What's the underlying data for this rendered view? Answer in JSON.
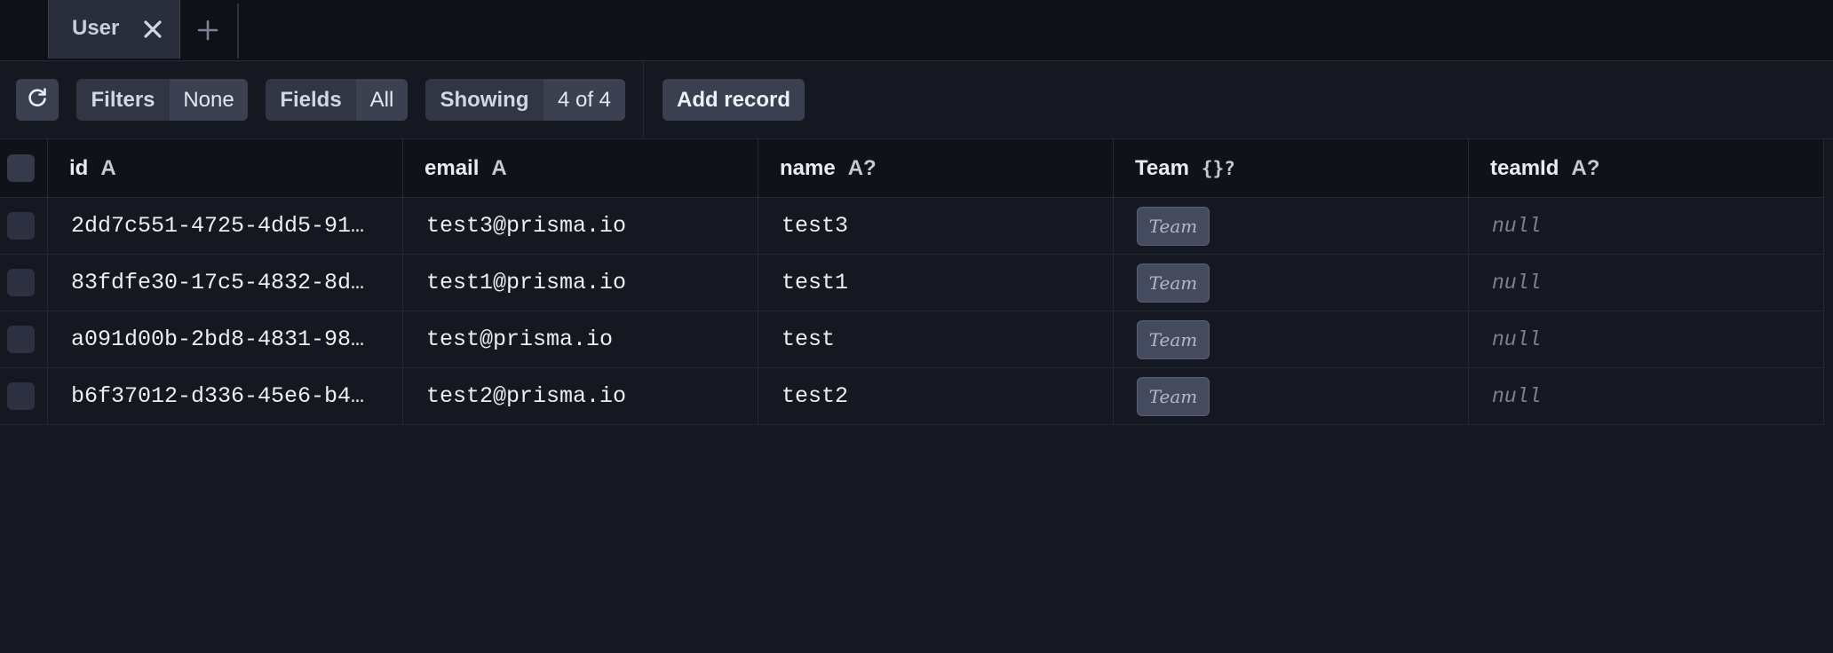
{
  "tabs": [
    {
      "label": "User",
      "active": true
    }
  ],
  "toolbar": {
    "filters_label": "Filters",
    "filters_value": "None",
    "fields_label": "Fields",
    "fields_value": "All",
    "showing_label": "Showing",
    "showing_value": "4 of 4",
    "add_record_label": "Add record"
  },
  "table": {
    "columns": [
      {
        "name": "id",
        "type": "A"
      },
      {
        "name": "email",
        "type": "A"
      },
      {
        "name": "name",
        "type": "A?"
      },
      {
        "name": "Team",
        "type": "{}?"
      },
      {
        "name": "teamId",
        "type": "A?"
      }
    ],
    "rows": [
      {
        "id": "2dd7c551-4725-4dd5-91…",
        "email": "test3@prisma.io",
        "name": "test3",
        "team": "Team",
        "teamId": "null"
      },
      {
        "id": "83fdfe30-17c5-4832-8d…",
        "email": "test1@prisma.io",
        "name": "test1",
        "team": "Team",
        "teamId": "null"
      },
      {
        "id": "a091d00b-2bd8-4831-98…",
        "email": "test@prisma.io",
        "name": "test",
        "team": "Team",
        "teamId": "null"
      },
      {
        "id": "b6f37012-d336-45e6-b4…",
        "email": "test2@prisma.io",
        "name": "test2",
        "team": "Team",
        "teamId": "null"
      }
    ]
  },
  "colors": {
    "background": "#161821",
    "tabbar": "#0f1117",
    "active_tab": "#2a2e3c",
    "button": "#3b4051",
    "chip": "#454b5e"
  },
  "icons": [
    "close-icon",
    "plus-icon",
    "refresh-icon"
  ]
}
